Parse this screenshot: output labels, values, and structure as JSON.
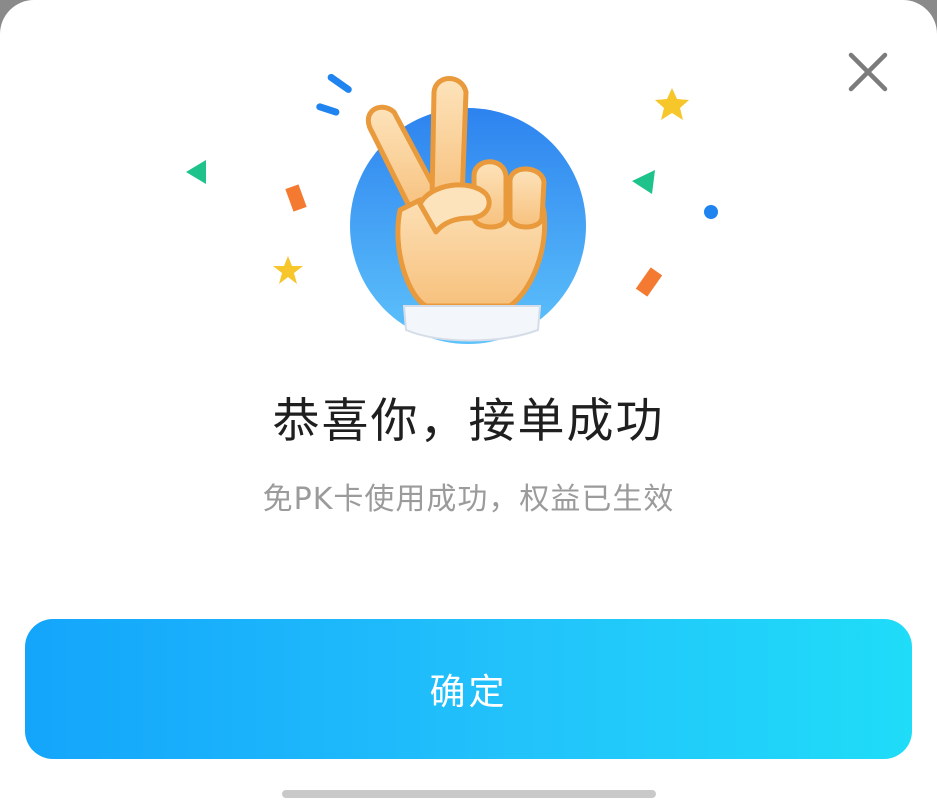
{
  "dialog": {
    "title": "恭喜你，接单成功",
    "subtitle": "免PK卡使用成功，权益已生效",
    "confirm_label": "确定",
    "close_icon": "close-icon",
    "illustration_icon": "victory-hand-icon"
  },
  "colors": {
    "button_start": "#14a5fb",
    "button_end": "#1fdcf8",
    "circle_blue": "#2c8df2",
    "title_text": "#1f1f1f",
    "subtitle_text": "#9b9b9b"
  }
}
